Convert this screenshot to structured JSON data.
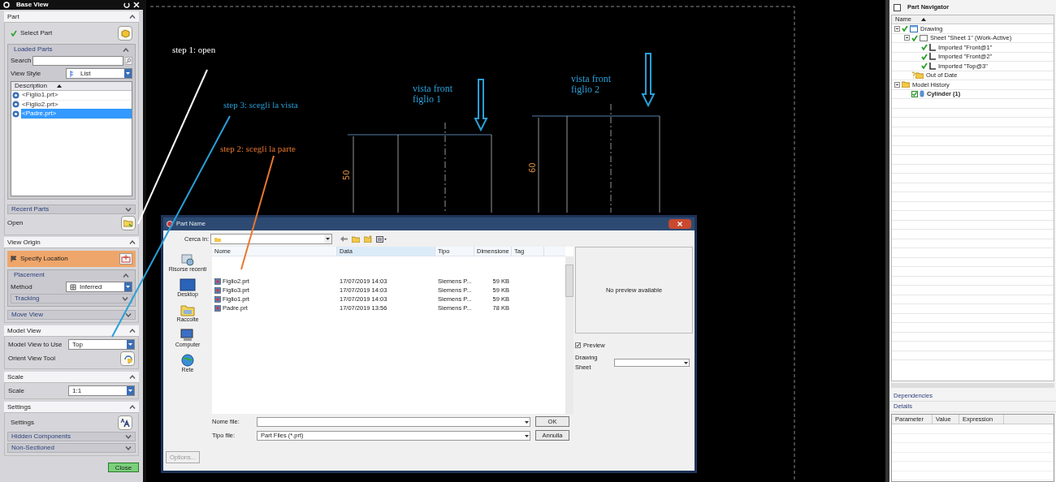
{
  "base_view": {
    "title": "Base View",
    "part": {
      "header": {
        "label": "Part",
        "expanded": true
      },
      "select_label": "Select Part",
      "loaded_parts": {
        "header": {
          "label": "Loaded Parts",
          "expanded": true
        },
        "search_label": "Search",
        "view_style_label": "View Style",
        "view_style_value": "List",
        "column": "Description",
        "items": [
          {
            "label": "<Figlio1.prt>",
            "selected": false
          },
          {
            "label": "<Figlio2.prt>",
            "selected": false
          },
          {
            "label": "<Padre.prt>",
            "selected": true
          }
        ]
      },
      "recent_parts": {
        "label": "Recent Parts",
        "expanded": false
      },
      "open_label": "Open"
    },
    "view_origin": {
      "header": {
        "label": "View Origin",
        "expanded": true
      },
      "specify_location": "Specify Location",
      "placement": {
        "header": {
          "label": "Placement",
          "expanded": true
        },
        "method_label": "Method",
        "method_value": "Inferred",
        "tracking": {
          "label": "Tracking",
          "expanded": false
        }
      },
      "move_view": {
        "label": "Move View",
        "expanded": false
      }
    },
    "model_view": {
      "header": {
        "label": "Model View",
        "expanded": true
      },
      "use_label": "Model View to Use",
      "use_value": "Top",
      "orient_label": "Orient View Tool"
    },
    "scale": {
      "header": {
        "label": "Scale",
        "expanded": true
      },
      "label": "Scale",
      "value": "1:1"
    },
    "settings": {
      "header": {
        "label": "Settings",
        "expanded": true
      },
      "label": "Settings",
      "hidden_components": {
        "label": "Hidden Components",
        "expanded": false
      },
      "non_sectioned": {
        "label": "Non-Sectioned",
        "expanded": false
      }
    },
    "close_button": "Close"
  },
  "drawing": {
    "views": [
      {
        "caption": "vista front figlio 1",
        "dimension": "50"
      },
      {
        "caption": "vista front figlio 2",
        "dimension": "60"
      }
    ]
  },
  "annotations": [
    {
      "text": "step 1: open",
      "color": "#ffffff"
    },
    {
      "text": "step 3: scegli la vista",
      "color": "#2a9fd8"
    },
    {
      "text": "step 2: scegli la parte",
      "color": "#e8772e"
    }
  ],
  "dialog": {
    "title": "Part Name",
    "look_in_label": "Cerca in:",
    "places": [
      "Risorse recenti",
      "Desktop",
      "Raccolte",
      "Computer",
      "Rete"
    ],
    "columns": [
      "Nome",
      "Data",
      "Tipo",
      "Dimensione",
      "Tag"
    ],
    "files": [
      {
        "name": "Figlio2.prt",
        "date": "17/07/2019 14:03",
        "type": "Siemens P...",
        "size": "59 KB"
      },
      {
        "name": "Figlio3.prt",
        "date": "17/07/2019 14:03",
        "type": "Siemens P...",
        "size": "59 KB"
      },
      {
        "name": "Figlio1.prt",
        "date": "17/07/2019 14:03",
        "type": "Siemens P...",
        "size": "59 KB"
      },
      {
        "name": "Padre.prt",
        "date": "17/07/2019 13:56",
        "type": "Siemens P...",
        "size": "78 KB"
      }
    ],
    "file_name_label": "Nome file:",
    "file_type_label": "Tipo file:",
    "file_type_value": "Part Files (*.prt)",
    "ok_button": "OK",
    "cancel_button": "Annulla",
    "options_button": "Options...",
    "preview_message": "No preview available",
    "preview": {
      "label": "Preview",
      "checked": true
    },
    "drawing_sheet_label": "Drawing Sheet"
  },
  "navigator": {
    "title": "Part Navigator",
    "column": "Name",
    "tree": [
      {
        "label": "Drawing",
        "kind": "drawing",
        "checked": true,
        "children": [
          {
            "label": "Sheet \"Sheet 1\" (Work-Active)",
            "kind": "sheet",
            "checked": true,
            "children": [
              {
                "label": "Imported \"Front@1\"",
                "kind": "view",
                "checked": true
              },
              {
                "label": "Imported \"Front@2\"",
                "kind": "view",
                "checked": true
              },
              {
                "label": "Imported \"Top@3\"",
                "kind": "view",
                "checked": true
              }
            ]
          },
          {
            "label": "Out of Date",
            "kind": "outdated",
            "checked": false
          }
        ]
      },
      {
        "label": "Model History",
        "kind": "folder",
        "checked": false,
        "children": [
          {
            "label": "Cylinder (1)",
            "kind": "feature",
            "checked": true
          }
        ]
      }
    ],
    "panels": [
      "Dependencies",
      "Details"
    ],
    "detail_columns": [
      "Parameter",
      "Value",
      "Expression"
    ]
  }
}
